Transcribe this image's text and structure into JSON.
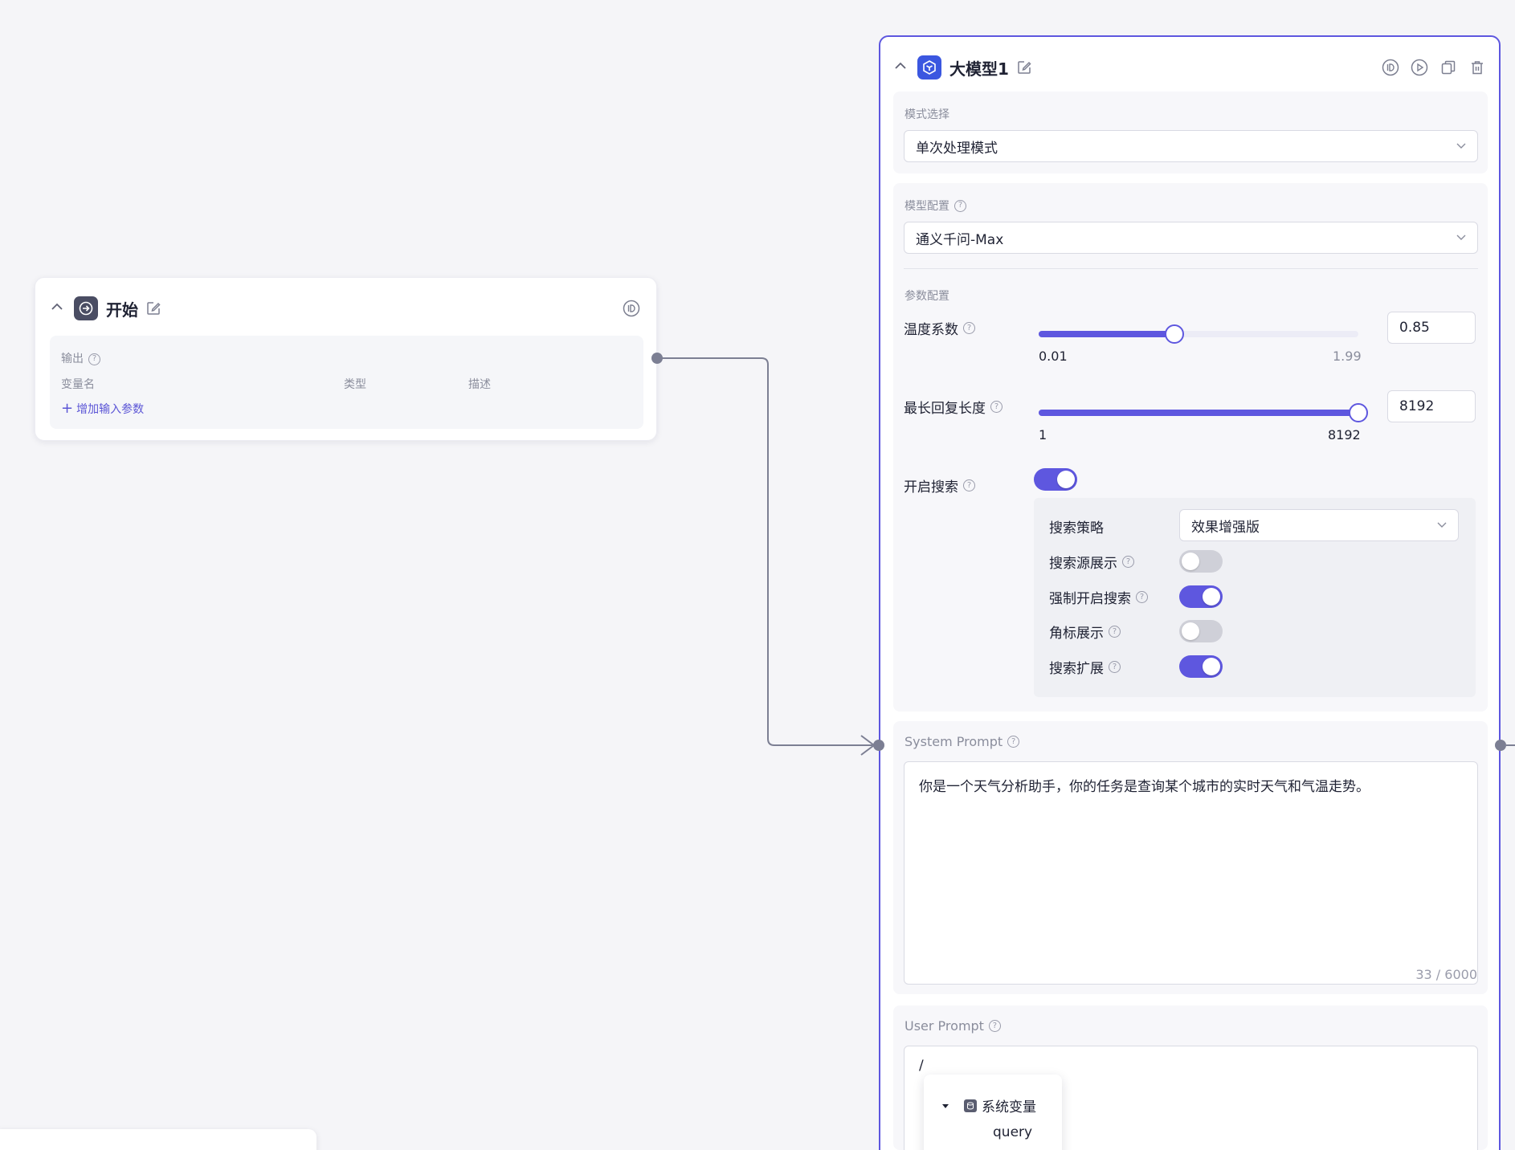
{
  "start_node": {
    "title": "开始",
    "output_label": "输出",
    "columns": [
      "变量名",
      "类型",
      "描述"
    ],
    "add_param": "增加输入参数"
  },
  "llm_node": {
    "title": "大模型1",
    "mode": {
      "label": "模式选择",
      "value": "单次处理模式"
    },
    "model": {
      "label": "模型配置",
      "value": "通义千问-Max"
    },
    "params": {
      "label": "参数配置",
      "temperature": {
        "label": "温度系数",
        "min": "0.01",
        "max": "1.99",
        "value": "0.85",
        "min_num": 0.01,
        "max_num": 1.99,
        "value_num": 0.85
      },
      "max_length": {
        "label": "最长回复长度",
        "min": "1",
        "max": "8192",
        "value": "8192",
        "min_num": 1,
        "max_num": 8192,
        "value_num": 8192
      }
    },
    "search": {
      "label": "开启搜索",
      "enabled": true,
      "strategy_label": "搜索策略",
      "strategy_value": "效果增强版",
      "options": [
        {
          "label": "搜索源展示",
          "on": false
        },
        {
          "label": "强制开启搜索",
          "on": true
        },
        {
          "label": "角标展示",
          "on": false
        },
        {
          "label": "搜索扩展",
          "on": true
        }
      ]
    },
    "system_prompt": {
      "label": "System Prompt",
      "text": "你是一个天气分析助手，你的任务是查询某个城市的实时天气和气温走势。",
      "count": "33 / 6000"
    },
    "user_prompt": {
      "label": "User Prompt",
      "text": "/"
    },
    "var_popup": {
      "group": "系统变量",
      "item": "query"
    }
  },
  "colors": {
    "accent": "#5e57df",
    "node_border": "#5e57df",
    "connector": "#7c7f93"
  }
}
